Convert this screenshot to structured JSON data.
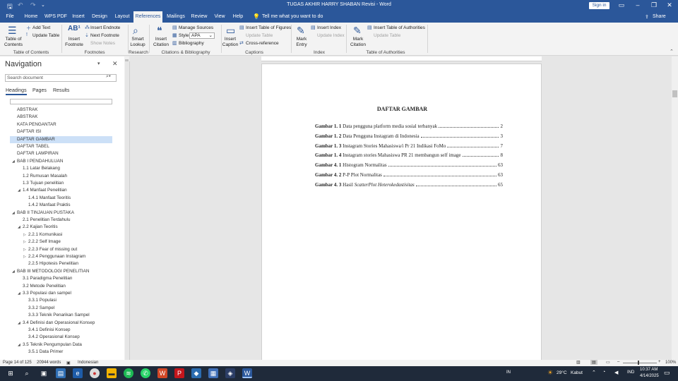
{
  "app": {
    "title": "TUGAS AKHIR HARRY SHABAN Revisi  -  Word",
    "sign_in": "Sign in"
  },
  "menu_tabs": [
    "File",
    "Home",
    "WPS PDF",
    "Insert",
    "Design",
    "Layout",
    "References",
    "Mailings",
    "Review",
    "View",
    "Help"
  ],
  "active_tab": "References",
  "tell_me": "Tell me what you want to do",
  "share": "Share",
  "ribbon": {
    "toc": {
      "big": "Table of Contents",
      "add_text": "Add Text",
      "update_table": "Update Table",
      "group": "Table of Contents"
    },
    "footnotes": {
      "insert_footnote": "Insert Footnote",
      "insert_endnote": "Insert Endnote",
      "next_footnote": "Next Footnote",
      "show_notes": "Show Notes",
      "group": "Footnotes"
    },
    "research": {
      "smart_lookup": "Smart Lookup",
      "group": "Research"
    },
    "citations": {
      "insert_citation": "Insert Citation",
      "manage_sources": "Manage Sources",
      "style_label": "Style:",
      "style_value": "APA",
      "bibliography": "Bibliography",
      "group": "Citations & Bibliography"
    },
    "captions": {
      "insert_caption": "Insert Caption",
      "insert_table_figures": "Insert Table of Figures",
      "update_table": "Update Table",
      "cross_reference": "Cross-reference",
      "group": "Captions"
    },
    "index": {
      "mark_entry": "Mark Entry",
      "insert_index": "Insert Index",
      "update_index": "Update Index",
      "group": "Index"
    },
    "authorities": {
      "mark_citation": "Mark Citation",
      "insert_table": "Insert Table of Authorities",
      "update_table": "Update Table",
      "group": "Table of Authorities"
    }
  },
  "navigation": {
    "title": "Navigation",
    "search_placeholder": "Search document",
    "tabs": [
      "Headings",
      "Pages",
      "Results"
    ],
    "active_tab": "Headings",
    "headings": [
      {
        "label": "ABSTRAK",
        "level": 0,
        "tri": ""
      },
      {
        "label": "ABSTRAK",
        "level": 0,
        "tri": ""
      },
      {
        "label": "KATA PENGANTAR",
        "level": 0,
        "tri": ""
      },
      {
        "label": "DAFTAR ISI",
        "level": 0,
        "tri": ""
      },
      {
        "label": "DAFTAR GAMBAR",
        "level": 0,
        "tri": "",
        "selected": true
      },
      {
        "label": "DAFTAR TABEL",
        "level": 0,
        "tri": ""
      },
      {
        "label": "DAFTAR LAMPIRAN",
        "level": 0,
        "tri": ""
      },
      {
        "label": "BAB I   PENDAHULUAN",
        "level": 0,
        "tri": "◢"
      },
      {
        "label": "1.1 Latar Belakang",
        "level": 1,
        "tri": ""
      },
      {
        "label": "1.2 Rumusan Masalah",
        "level": 1,
        "tri": ""
      },
      {
        "label": "1.3 Tujuan penelitian",
        "level": 1,
        "tri": ""
      },
      {
        "label": "1.4 Manfaat Penelitian",
        "level": 1,
        "tri": "◢"
      },
      {
        "label": "1.4.1 Manfaat Teoritis",
        "level": 2,
        "tri": ""
      },
      {
        "label": "1.4.2 Manfaat Praktis",
        "level": 2,
        "tri": ""
      },
      {
        "label": "BAB II   TINJAUAN PUSTAKA",
        "level": 0,
        "tri": "◢"
      },
      {
        "label": "2.1 Penelitian Terdahulu",
        "level": 1,
        "tri": ""
      },
      {
        "label": "2.2 Kajian Teoritis",
        "level": 1,
        "tri": "◢"
      },
      {
        "label": "2.2.1 Komunikasi",
        "level": 2,
        "tri": "▷"
      },
      {
        "label": "2.2.2   Self Image",
        "level": 2,
        "tri": "▷"
      },
      {
        "label": "2.2.3   Fear of missing out",
        "level": 2,
        "tri": "▷"
      },
      {
        "label": "2.2.4 Penggunaan Instagram",
        "level": 2,
        "tri": "▷"
      },
      {
        "label": "2.2.5 Hipotesis Penelitian",
        "level": 2,
        "tri": ""
      },
      {
        "label": "BAB III   METODOLOGI PENELITIAN",
        "level": 0,
        "tri": "◢"
      },
      {
        "label": "3.1 Paradigma Penelitian",
        "level": 1,
        "tri": ""
      },
      {
        "label": "3.2 Metode Penelitian",
        "level": 1,
        "tri": ""
      },
      {
        "label": "3.3 Populasi dan sampel",
        "level": 1,
        "tri": "◢"
      },
      {
        "label": "3.3.1 Populasi",
        "level": 2,
        "tri": ""
      },
      {
        "label": "3.3.2 Sampel",
        "level": 2,
        "tri": ""
      },
      {
        "label": "3.3.3 Teknik Penarikan Sampel",
        "level": 2,
        "tri": ""
      },
      {
        "label": "3.4 Definisi dan Operasional Konsep",
        "level": 1,
        "tri": "◢"
      },
      {
        "label": "3.4.1 Definisi Konsep",
        "level": 2,
        "tri": ""
      },
      {
        "label": "3.4.2 Operasional Konsep",
        "level": 2,
        "tri": ""
      },
      {
        "label": "3.5 Teknik Pengumpulan Data",
        "level": 1,
        "tri": "◢"
      },
      {
        "label": "3.5.1 Data Primer",
        "level": 2,
        "tri": ""
      }
    ]
  },
  "document": {
    "heading": "DAFTAR GAMBAR",
    "entries": [
      {
        "bold": "Gambar 1. 1",
        "text": " Data pengguna platform media sosial terbanyak",
        "italic": "",
        "page": "2"
      },
      {
        "bold": "Gambar 1. 2",
        "text": " Data Pengguna Instagram di Indonesia",
        "italic": "",
        "page": "3"
      },
      {
        "bold": "Gambar 1. 3",
        "text": " Instagram Stories Mahasiswa/i Pr 21 Indikasi FoMo",
        "italic": "",
        "page": "7"
      },
      {
        "bold": "Gambar 1. 4",
        "text": " Instagram stories Mahasiswa PR 21 membangun self image",
        "italic": "",
        "page": "8"
      },
      {
        "bold": "Gambar 4. 1",
        "text": " Histogram Normalitas",
        "italic": "",
        "page": "63"
      },
      {
        "bold": "Gambar 4. 2",
        "text": " P-P Plot Normalitas",
        "italic": "",
        "page": "63"
      },
      {
        "bold": "Gambar 4. 3",
        "text": " Hasil ",
        "italic": "ScatterPlot Heterokedastisitas",
        "page": "65"
      }
    ]
  },
  "status": {
    "page": "Page 14 of 125",
    "words": "20944 words",
    "language": "Indonesian",
    "zoom": "100%"
  },
  "taskbar": {
    "temperature": "29°C",
    "weather": "Kabut",
    "lang": "IND",
    "input": "IN",
    "time": "10:37 AM",
    "date": "4/14/2025"
  }
}
